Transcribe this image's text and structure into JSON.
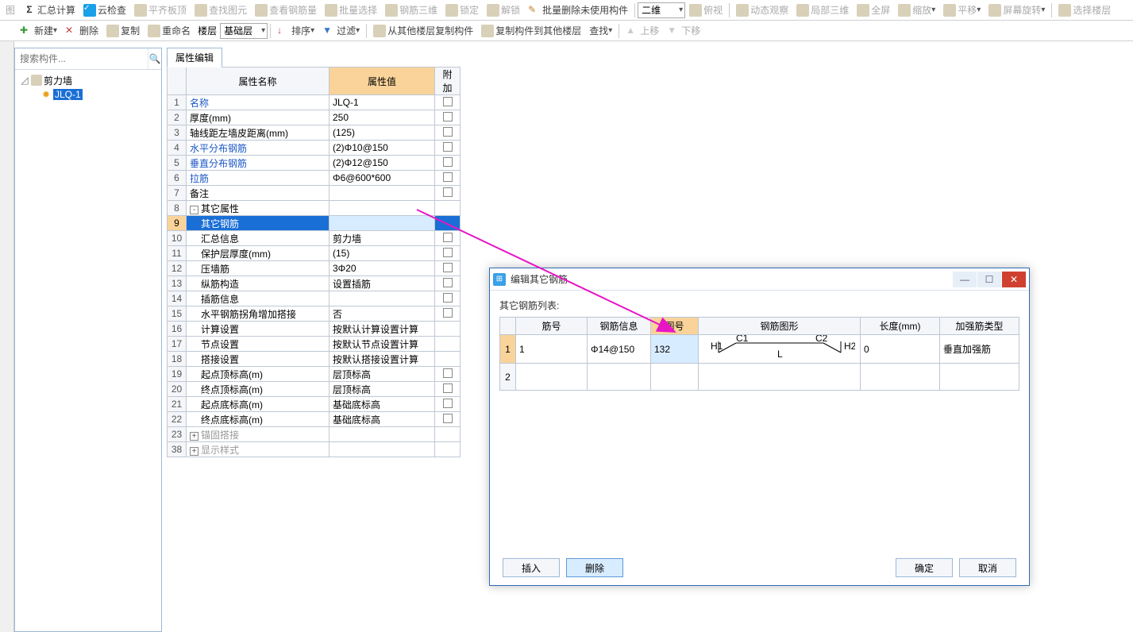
{
  "toolbar1": {
    "items": [
      {
        "label": "图",
        "disabled": true
      },
      {
        "label": "汇总计算",
        "icon": "Σ"
      },
      {
        "label": "云检查",
        "icon": "cloud"
      },
      {
        "label": "平齐板顶",
        "disabled": true
      },
      {
        "label": "查找图元",
        "disabled": true
      },
      {
        "label": "查看钢筋量",
        "disabled": true
      },
      {
        "label": "批量选择",
        "disabled": true
      },
      {
        "label": "钢筋三维",
        "disabled": true
      },
      {
        "label": "锁定",
        "disabled": true
      },
      {
        "label": "解锁",
        "disabled": true
      },
      {
        "label": "批量删除未使用构件",
        "icon": "brush"
      }
    ],
    "view_combo": "二维",
    "view_items": [
      {
        "label": "俯视",
        "disabled": true
      },
      {
        "label": "动态观察",
        "disabled": true
      },
      {
        "label": "局部三维",
        "disabled": true
      },
      {
        "label": "全屏",
        "disabled": true
      },
      {
        "label": "缩放",
        "drop": true,
        "disabled": true
      },
      {
        "label": "平移",
        "drop": true,
        "disabled": true
      },
      {
        "label": "屏幕旋转",
        "drop": true,
        "disabled": true
      },
      {
        "label": "选择楼层",
        "disabled": true
      }
    ]
  },
  "toolbar2": {
    "items": [
      {
        "label": "新建",
        "drop": true,
        "icon": "new"
      },
      {
        "label": "删除"
      },
      {
        "label": "复制"
      },
      {
        "label": "重命名"
      }
    ],
    "floor_label": "楼层",
    "floor_combo": "基础层",
    "sort_label": "排序",
    "sort_drop": true,
    "filter_label": "过滤",
    "filter_drop": true,
    "copy_from": "从其他楼层复制构件",
    "copy_to": "复制构件到其他楼层",
    "find_label": "查找",
    "find_drop": true,
    "up": "上移",
    "down": "下移"
  },
  "search_placeholder": "搜索构件...",
  "tree": {
    "root": "剪力墙",
    "child": "JLQ-1"
  },
  "prop_tab": "属性编辑",
  "prop_headers": {
    "name": "属性名称",
    "value": "属性值",
    "att": "附加"
  },
  "prop_rows": [
    {
      "n": 1,
      "name": "名称",
      "blue": true,
      "val": "JLQ-1",
      "chk": false
    },
    {
      "n": 2,
      "name": "厚度(mm)",
      "val": "250",
      "chk": true
    },
    {
      "n": 3,
      "name": "轴线距左墙皮距离(mm)",
      "val": "(125)",
      "chk": true
    },
    {
      "n": 4,
      "name": "水平分布钢筋",
      "blue": true,
      "val": "(2)Φ10@150",
      "chk": true
    },
    {
      "n": 5,
      "name": "垂直分布钢筋",
      "blue": true,
      "val": "(2)Φ12@150",
      "chk": true
    },
    {
      "n": 6,
      "name": "拉筋",
      "blue": true,
      "val": "Φ6@600*600",
      "chk": true
    },
    {
      "n": 7,
      "name": "备注",
      "val": "",
      "chk": true
    },
    {
      "n": 8,
      "name": "其它属性",
      "group": true,
      "exp": "-"
    },
    {
      "n": 9,
      "name": "其它钢筋",
      "indent": 1,
      "sel": true,
      "val": ""
    },
    {
      "n": 10,
      "name": "汇总信息",
      "indent": 1,
      "val": "剪力墙",
      "chk": true
    },
    {
      "n": 11,
      "name": "保护层厚度(mm)",
      "indent": 1,
      "val": "(15)",
      "chk": true
    },
    {
      "n": 12,
      "name": "压墙筋",
      "indent": 1,
      "val": "3Φ20",
      "chk": true
    },
    {
      "n": 13,
      "name": "纵筋构造",
      "indent": 1,
      "val": "设置插筋",
      "chk": true
    },
    {
      "n": 14,
      "name": "插筋信息",
      "indent": 1,
      "val": "",
      "chk": true
    },
    {
      "n": 15,
      "name": "水平钢筋拐角增加搭接",
      "indent": 1,
      "val": "否",
      "chk": true
    },
    {
      "n": 16,
      "name": "计算设置",
      "indent": 1,
      "val": "按默认计算设置计算"
    },
    {
      "n": 17,
      "name": "节点设置",
      "indent": 1,
      "val": "按默认节点设置计算"
    },
    {
      "n": 18,
      "name": "搭接设置",
      "indent": 1,
      "val": "按默认搭接设置计算"
    },
    {
      "n": 19,
      "name": "起点顶标高(m)",
      "indent": 1,
      "val": "层顶标高",
      "chk": true
    },
    {
      "n": 20,
      "name": "终点顶标高(m)",
      "indent": 1,
      "val": "层顶标高",
      "chk": true
    },
    {
      "n": 21,
      "name": "起点底标高(m)",
      "indent": 1,
      "val": "基础底标高",
      "chk": true
    },
    {
      "n": 22,
      "name": "终点底标高(m)",
      "indent": 1,
      "val": "基础底标高",
      "chk": true
    },
    {
      "n": 23,
      "name": "锚固搭接",
      "group": true,
      "exp": "+",
      "gray": true
    },
    {
      "n": 38,
      "name": "显示样式",
      "group": true,
      "exp": "+",
      "gray": true
    }
  ],
  "dialog": {
    "title": "编辑其它钢筋",
    "list_label": "其它钢筋列表:",
    "headers": [
      "筋号",
      "钢筋信息",
      "图号",
      "钢筋图形",
      "长度(mm)",
      "加强筋类型"
    ],
    "rows": [
      {
        "n": 1,
        "jh": "1",
        "info": "Φ14@150",
        "tuhao": "132",
        "graph": {
          "h1": "H1",
          "c1": "C1",
          "c2": "C2",
          "h2": "H2",
          "l": "L"
        },
        "len": "0",
        "type": "垂直加强筋",
        "sel": true
      },
      {
        "n": 2
      }
    ],
    "btns": {
      "insert": "插入",
      "delete": "删除",
      "ok": "确定",
      "cancel": "取消"
    }
  }
}
